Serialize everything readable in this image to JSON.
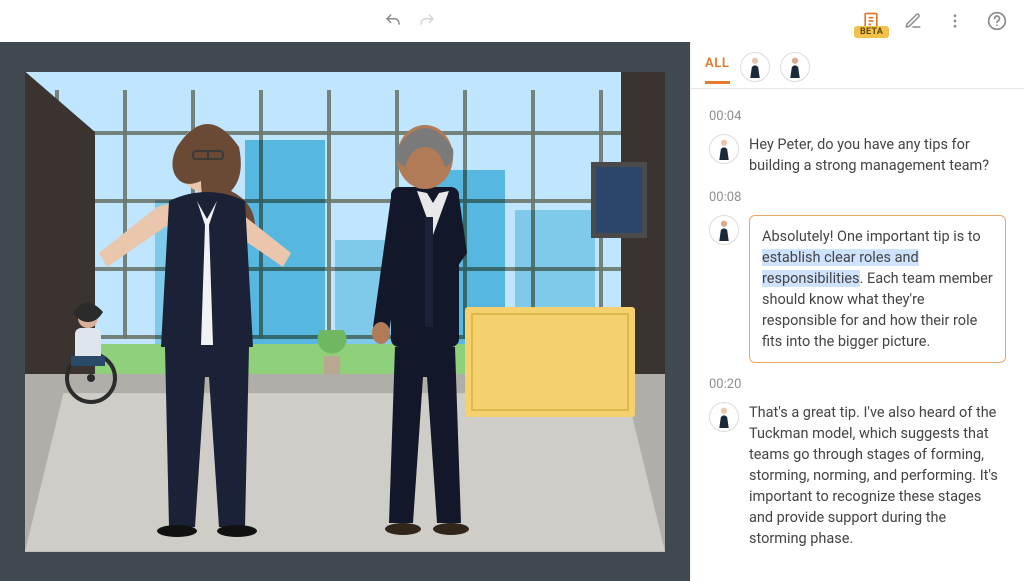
{
  "topbar": {
    "undo_icon": "undo-icon",
    "redo_icon": "redo-icon",
    "notes_icon": "notes-icon",
    "beta_label": "BETA",
    "edit_icon": "pencil-icon",
    "more_icon": "more-vertical-icon",
    "help_icon": "help-circle-icon"
  },
  "transcript": {
    "tab_all_label": "ALL",
    "speakers": [
      "speaker-1",
      "speaker-2"
    ],
    "entries": [
      {
        "timestamp": "00:04",
        "speaker": "speaker-1",
        "text": "Hey Peter, do you have any tips for building a strong management team?",
        "active": false
      },
      {
        "timestamp": "00:08",
        "speaker": "speaker-2",
        "text_pre": "Absolutely! One important tip is to ",
        "text_hl": "establish clear roles and responsibilities",
        "text_post": ". Each team member should know what they're responsible for and how their role fits into the bigger picture.",
        "active": true
      },
      {
        "timestamp": "00:20",
        "speaker": "speaker-1",
        "text": "That's a great tip. I've also heard of the Tuckman model, which suggests that teams go through stages of forming, storming, norming, and performing. It's important to recognize these stages and provide support during the storming phase.",
        "active": false
      }
    ]
  }
}
